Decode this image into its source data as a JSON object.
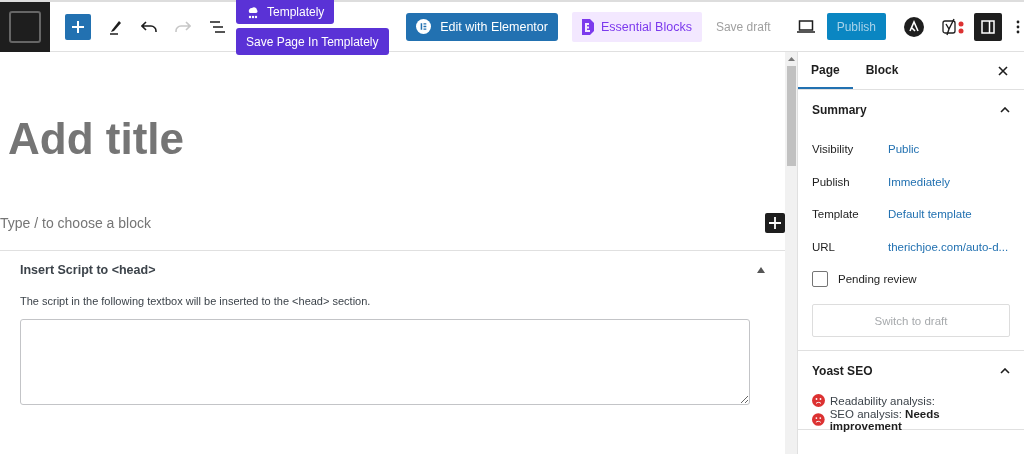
{
  "toolbar": {
    "templately_menu": [
      {
        "label": "Templately",
        "kind": "brand"
      },
      {
        "label": "Save Page In Templately",
        "kind": "plain"
      }
    ],
    "edit_with_elementor": "Edit with Elementor",
    "essential_blocks": "Essential Blocks",
    "save_draft": "Save draft",
    "publish": "Publish"
  },
  "editor": {
    "title_placeholder": "Add title",
    "block_placeholder": "Type / to choose a block"
  },
  "metabox": {
    "title": "Insert Script to <head>",
    "expanded": true,
    "description": "The script in the following textbox will be inserted to the <head> section."
  },
  "sidebar": {
    "tabs": [
      {
        "label": "Page",
        "selected": true
      },
      {
        "label": "Block",
        "selected": false
      }
    ],
    "summary": {
      "title": "Summary",
      "expanded": true,
      "rows": [
        {
          "label": "Visibility",
          "value": "Public"
        },
        {
          "label": "Publish",
          "value": "Immediately"
        },
        {
          "label": "Template",
          "value": "Default template"
        },
        {
          "label": "URL",
          "value": "therichjoe.com/auto-d..."
        }
      ],
      "pending_review": {
        "label": "Pending review",
        "checked": false
      },
      "switch_button": "Switch to draft"
    },
    "yoast": {
      "title": "Yoast SEO",
      "expanded": true,
      "analyses": [
        {
          "text": "Readability analysis:",
          "color": "#dc3232"
        },
        {
          "text": "SEO analysis: **Needs improvement**",
          "color": "#dc3232"
        }
      ]
    }
  }
}
